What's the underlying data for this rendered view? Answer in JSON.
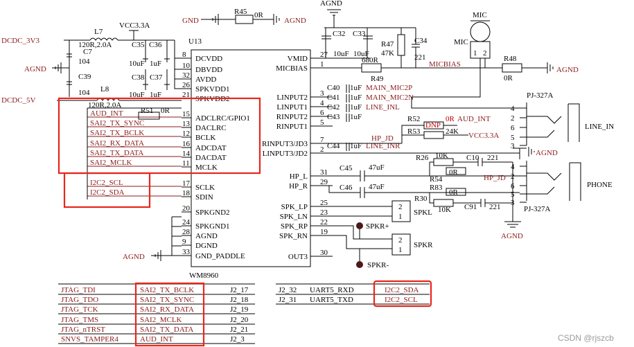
{
  "chip": {
    "ref": "U13",
    "part": "WM8960",
    "left_pins": [
      {
        "num": "8",
        "name": "DCVDD"
      },
      {
        "num": "10",
        "name": "DBVDD"
      },
      {
        "num": "32",
        "name": "AVDD"
      },
      {
        "num": "26",
        "name": "SPKVDD1"
      },
      {
        "num": "21",
        "name": "SPKVDD2"
      },
      {
        "num": "15",
        "name": "ADCLRC/GPIO1"
      },
      {
        "num": "13",
        "name": "DACLRC"
      },
      {
        "num": "12",
        "name": "BCLK"
      },
      {
        "num": "16",
        "name": "ADCDAT"
      },
      {
        "num": "14",
        "name": "DACDAT"
      },
      {
        "num": "11",
        "name": "MCLK"
      },
      {
        "num": "17",
        "name": "SCLK"
      },
      {
        "num": "18",
        "name": "SDIN"
      },
      {
        "num": "20",
        "name": "SPKGND2"
      },
      {
        "num": "24",
        "name": "SPKGND1"
      },
      {
        "num": "28",
        "name": "AGND"
      },
      {
        "num": "9",
        "name": "DGND"
      },
      {
        "num": "33",
        "name": "GND_PADDLE"
      }
    ],
    "right_pins": [
      {
        "num": "27",
        "name": "VMID"
      },
      {
        "num": "1",
        "name": "MICBIAS"
      },
      {
        "num": "3",
        "name": "LINPUT2"
      },
      {
        "num": "4",
        "name": "LINPUT1"
      },
      {
        "num": "6",
        "name": "RINPUT2"
      },
      {
        "num": "5",
        "name": "RINPUT1"
      },
      {
        "num": "7",
        "name": "RINPUT3/JD3"
      },
      {
        "num": "2",
        "name": "LINPUT3/JD2"
      },
      {
        "num": "31",
        "name": "HP_L"
      },
      {
        "num": "29",
        "name": "HP_R"
      },
      {
        "num": "25",
        "name": "SPK_LP"
      },
      {
        "num": "23",
        "name": "SPK_LN"
      },
      {
        "num": "22",
        "name": "SPK_RP"
      },
      {
        "num": "19",
        "name": "SPK_RN"
      },
      {
        "num": "30",
        "name": "OUT3"
      }
    ]
  },
  "nets_left": [
    "AUD_INT",
    "SAI2_TX_SYNC",
    "SAI2_TX_BCLK",
    "SAI2_RX_DATA",
    "SAI2_TX_DATA",
    "SAI2_MCLK",
    "I2C2_SCL",
    "I2C2_SDA"
  ],
  "power": {
    "dcdc3v3": "DCDC_3V3",
    "dcdc5v": "DCDC_5V",
    "vcc33a": "VCC3.3A",
    "agnd": "AGND",
    "gnd": "GND",
    "l7": "L7",
    "l7v": "120R,2.0A",
    "l8": "L8",
    "l8v": "120R,2.0A",
    "c7": "C7",
    "c7v": "104",
    "c39": "C39",
    "c39v": "104",
    "c35": "C35",
    "c36": "C36",
    "c38": "C38",
    "c37": "C37",
    "c10uf": "10uF",
    "c1uf": "1uF",
    "r45": "R45",
    "r45v": "0R"
  },
  "mic": {
    "mic": "MIC",
    "mic2": "MIC",
    "c32": "C32",
    "c33": "C33",
    "c10uf": "10uF",
    "r47": "R47",
    "r47v": "47K",
    "c34": "C34",
    "c34v": "221",
    "r49": "R49",
    "r49v": "680R",
    "micbias": "MICBIAS",
    "r48": "R48",
    "r48v": "0R",
    "p1": "1",
    "p2": "2"
  },
  "inputs": [
    {
      "cap": "C40",
      "val": "1uF",
      "net": "MAIN_MIC2P"
    },
    {
      "cap": "C41",
      "val": "1uF",
      "net": "MAIN_MIC2N"
    },
    {
      "cap": "C42",
      "val": "1uF",
      "net": "LINE_INL"
    },
    {
      "cap": "C43",
      "val": "1uF",
      "net": ""
    },
    {
      "cap": "C44",
      "val": "1uF",
      "net": "LINE_INR"
    }
  ],
  "jack1": {
    "ref": "PJ-327A",
    "label": "LINE_IN",
    "pins": [
      "4",
      "2",
      "6",
      "5",
      "3"
    ],
    "r51": "R51",
    "r51v": "0R",
    "r52": "R52",
    "r52v": "0R",
    "dnp": "DNP",
    "r53": "R53",
    "r53v": "24K",
    "audint": "AUD_INT",
    "hpjd": "HP_JD",
    "vcc": "VCC3.3A"
  },
  "jack2": {
    "ref": "PJ-327A",
    "label": "PHONE",
    "pins": [
      "4",
      "2",
      "6",
      "5",
      "3"
    ],
    "c45": "C45",
    "c46": "C46",
    "c47uf": "47uF",
    "r26": "R26",
    "r26v": "10K",
    "c10": "C10",
    "c10v": "221",
    "r54": "R54",
    "r54v": "0R",
    "hpjd": "HP_JD",
    "r83": "R83",
    "r83v": "0R",
    "r30": "R30",
    "r30v": "10K",
    "c91": "C91",
    "c91v": "221"
  },
  "speakers": {
    "spkl": "SPKL",
    "spkr": "SPKR",
    "spkrp": "SPKR+",
    "spkrm": "SPKR-",
    "p1": "1",
    "p2": "2"
  },
  "table_left": [
    {
      "a": "JTAG_TDI",
      "b": "SAI2_TX_BCLK",
      "c": "J2_17"
    },
    {
      "a": "JTAG_TDO",
      "b": "SAI2_TX_SYNC",
      "c": "J2_18"
    },
    {
      "a": "JTAG_TCK",
      "b": "SAI2_RX_DATA",
      "c": "J2_19"
    },
    {
      "a": "JTAG_TMS",
      "b": "SAI2_MCLK",
      "c": "J2_20"
    },
    {
      "a": "JTAG_nTRST",
      "b": "SAI2_TX_DATA",
      "c": "J2_21"
    },
    {
      "a": "SNVS_TAMPER4",
      "b": "AUD_INT",
      "c": "J2_3"
    }
  ],
  "table_right": [
    {
      "a": "J2_32",
      "b": "UART5_RXD",
      "c": "I2C2_SDA"
    },
    {
      "a": "J2_31",
      "b": "UART5_TXD",
      "c": "I2C2_SCL"
    }
  ],
  "watermark": "CSDN @rjszcb",
  "colors": {
    "wire": "#000000",
    "net": "#8b1a1a",
    "highlight": "#e8261a"
  }
}
